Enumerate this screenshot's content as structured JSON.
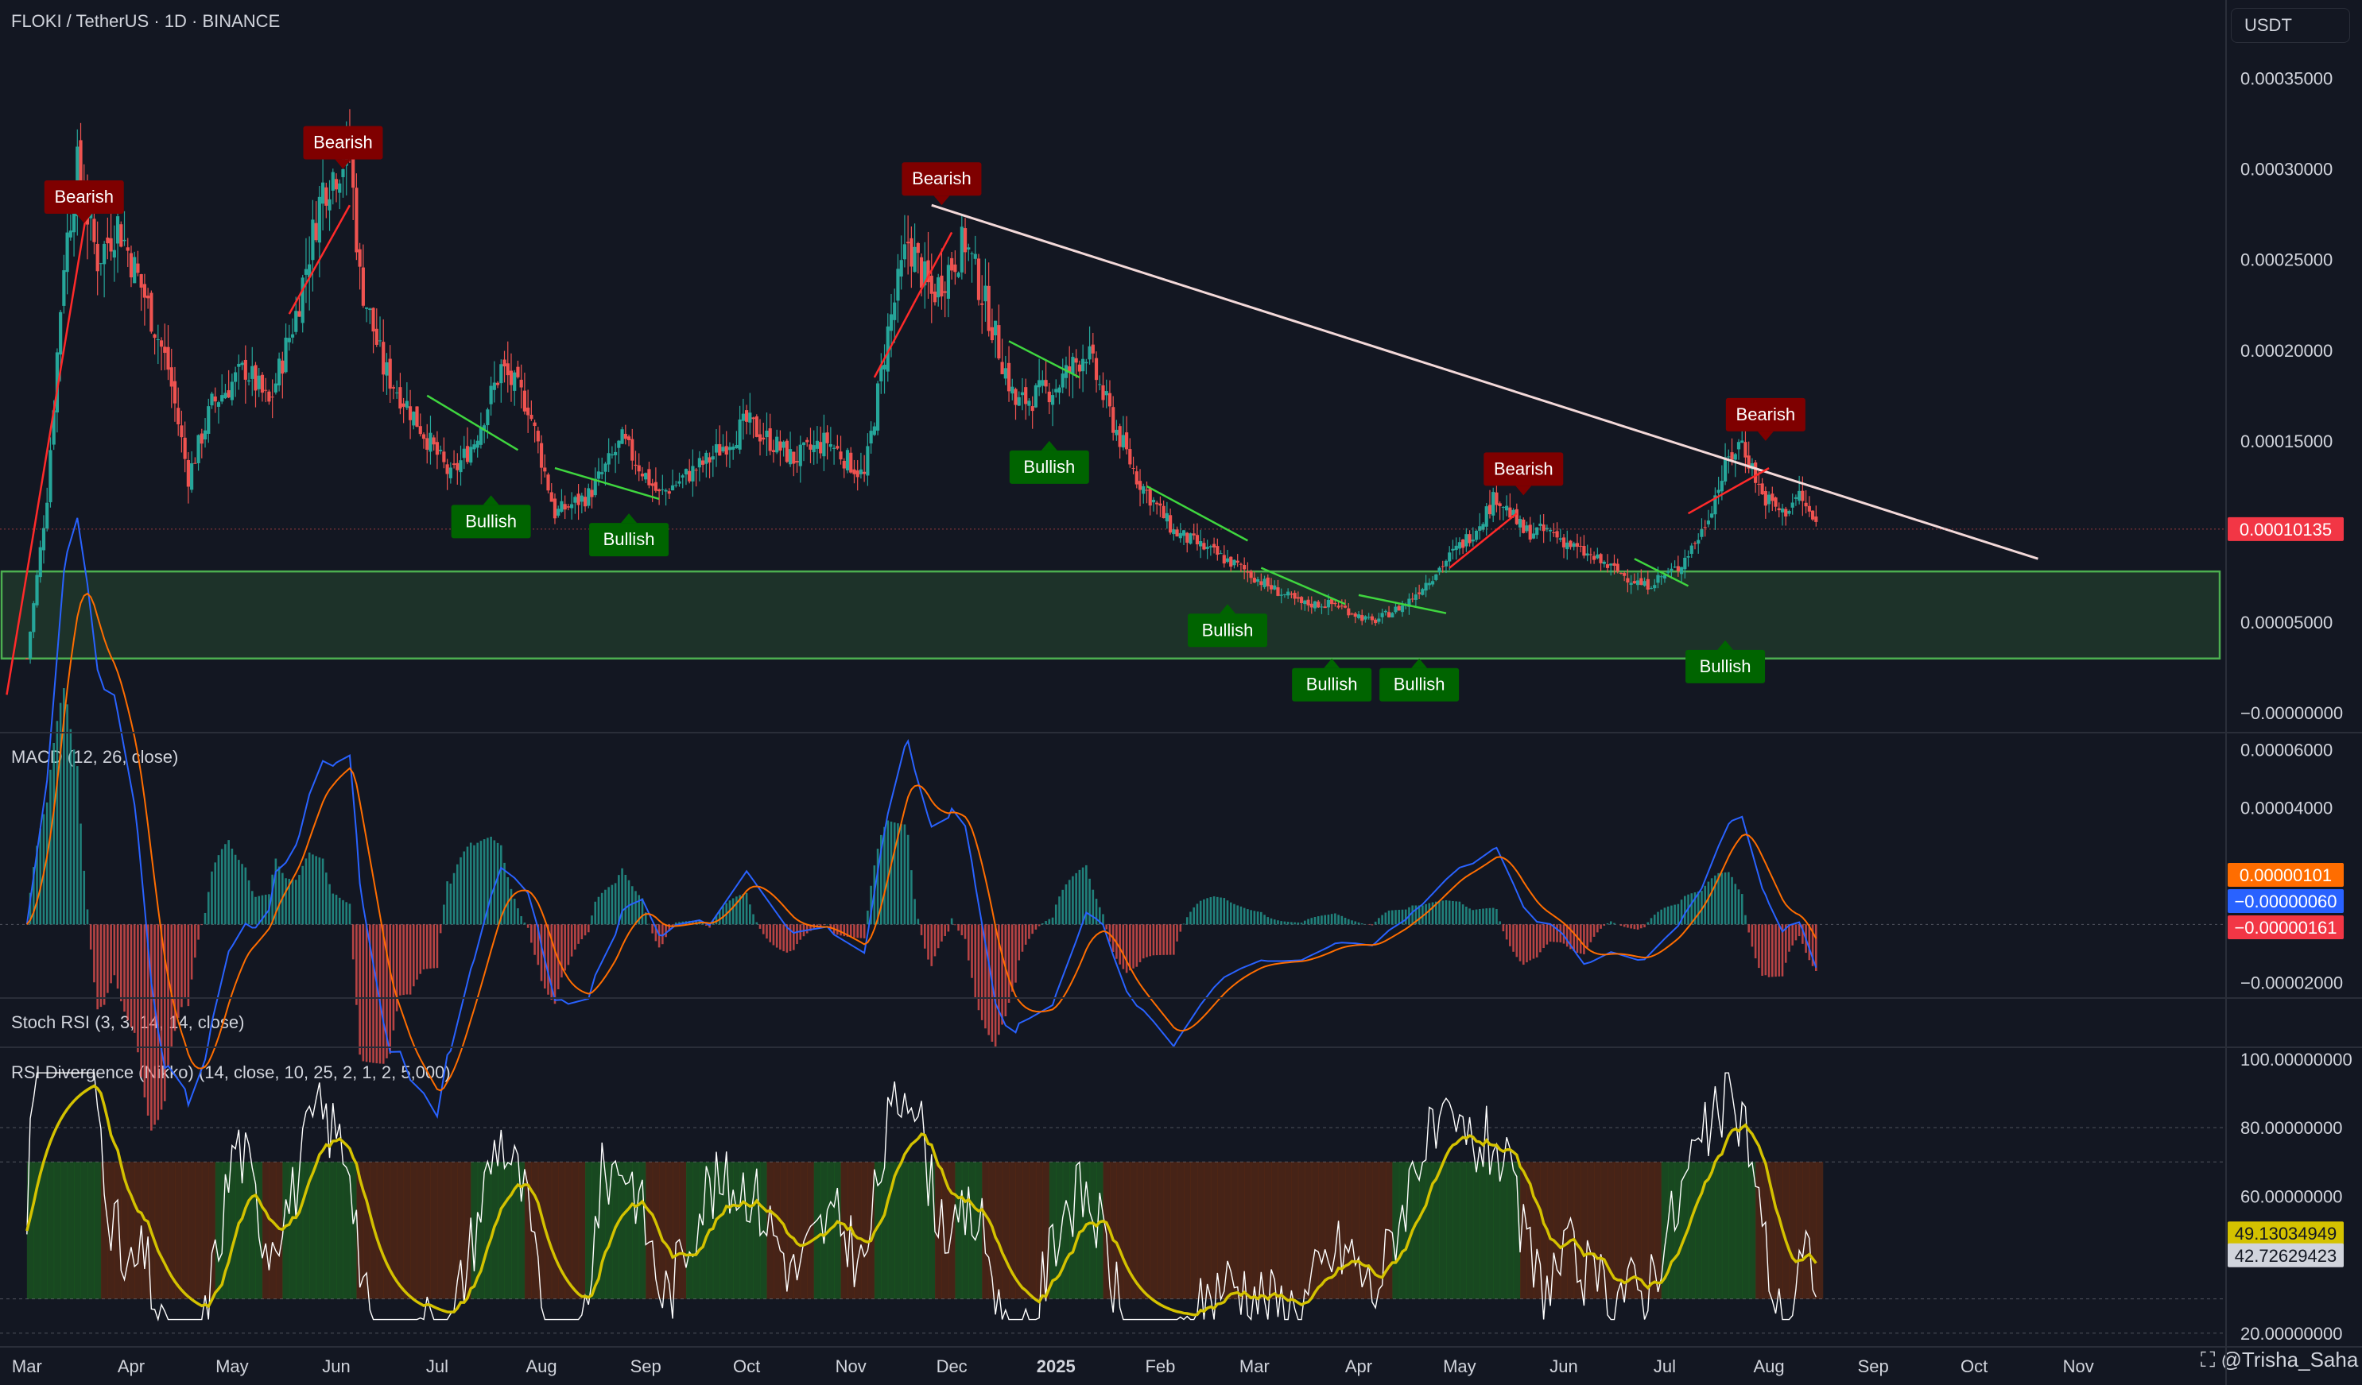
{
  "header": {
    "title": "FLOKI / TetherUS · 1D · BINANCE",
    "currency": "USDT"
  },
  "panes": {
    "macd_title": "MACD (12, 26, close)",
    "stoch_title": "Stoch RSI (3, 3, 14, 14, close)",
    "rsi_title": "RSI Divergence (Nikko) (14, close, 10, 25, 2, 1, 2, 5,000)"
  },
  "watermark": "@Trisha_Saha",
  "colors": {
    "background": "#131722",
    "bull_candle": "#26a69a",
    "bear_candle": "#ef5350",
    "bearish_label": "#7f0000",
    "bullish_label": "#006400",
    "support_zone": "#4caf50",
    "trendline": "#f3d9d9",
    "price_tag": "#f23645",
    "macd_line": "#2962ff",
    "signal_line": "#ff6d00",
    "rsi_line": "#ffffff",
    "rsi_ma": "#d4c200"
  },
  "chart_data": [
    {
      "type": "candlestick",
      "title": "FLOKI / TetherUS · 1D · BINANCE",
      "x_ticks": [
        "Mar",
        "Apr",
        "May",
        "Jun",
        "Jul",
        "Aug",
        "Sep",
        "Oct",
        "Nov",
        "Dec",
        "2025",
        "Feb",
        "Mar",
        "Apr",
        "May",
        "Jun",
        "Jul",
        "Aug",
        "Sep",
        "Oct",
        "Nov"
      ],
      "y_ticks": [
        "0.00035000",
        "0.00030000",
        "0.00025000",
        "0.00020000",
        "0.00015000",
        "0.00005000",
        "−0.00000000"
      ],
      "ylim": [
        -1e-05,
        0.00038
      ],
      "last_price": "0.00010135",
      "close_series": [
        {
          "date": "2024-03-01",
          "v": 3e-05
        },
        {
          "date": "2024-03-07",
          "v": 0.00012
        },
        {
          "date": "2024-03-12",
          "v": 0.00025
        },
        {
          "date": "2024-03-16",
          "v": 0.0003
        },
        {
          "date": "2024-03-22",
          "v": 0.00025
        },
        {
          "date": "2024-03-28",
          "v": 0.00027
        },
        {
          "date": "2024-04-05",
          "v": 0.00023
        },
        {
          "date": "2024-04-12",
          "v": 0.00019
        },
        {
          "date": "2024-04-18",
          "v": 0.00013
        },
        {
          "date": "2024-04-25",
          "v": 0.00017
        },
        {
          "date": "2024-05-05",
          "v": 0.00019
        },
        {
          "date": "2024-05-12",
          "v": 0.00017
        },
        {
          "date": "2024-05-20",
          "v": 0.00022
        },
        {
          "date": "2024-05-28",
          "v": 0.00029
        },
        {
          "date": "2024-06-05",
          "v": 0.00031
        },
        {
          "date": "2024-06-08",
          "v": 0.00024
        },
        {
          "date": "2024-06-15",
          "v": 0.00019
        },
        {
          "date": "2024-06-22",
          "v": 0.00017
        },
        {
          "date": "2024-07-05",
          "v": 0.00013
        },
        {
          "date": "2024-07-12",
          "v": 0.00015
        },
        {
          "date": "2024-07-20",
          "v": 0.00019
        },
        {
          "date": "2024-07-28",
          "v": 0.00017
        },
        {
          "date": "2024-08-05",
          "v": 0.00011
        },
        {
          "date": "2024-08-15",
          "v": 0.00012
        },
        {
          "date": "2024-08-25",
          "v": 0.00015
        },
        {
          "date": "2024-09-05",
          "v": 0.00012
        },
        {
          "date": "2024-09-20",
          "v": 0.00014
        },
        {
          "date": "2024-10-01",
          "v": 0.00016
        },
        {
          "date": "2024-10-15",
          "v": 0.00014
        },
        {
          "date": "2024-10-25",
          "v": 0.00015
        },
        {
          "date": "2024-11-05",
          "v": 0.00013
        },
        {
          "date": "2024-11-12",
          "v": 0.00021
        },
        {
          "date": "2024-11-18",
          "v": 0.00026
        },
        {
          "date": "2024-11-25",
          "v": 0.00023
        },
        {
          "date": "2024-12-05",
          "v": 0.00026
        },
        {
          "date": "2024-12-12",
          "v": 0.00022
        },
        {
          "date": "2024-12-20",
          "v": 0.00017
        },
        {
          "date": "2025-01-01",
          "v": 0.00018
        },
        {
          "date": "2025-01-10",
          "v": 0.0002
        },
        {
          "date": "2025-01-18",
          "v": 0.00016
        },
        {
          "date": "2025-01-25",
          "v": 0.00013
        },
        {
          "date": "2025-02-05",
          "v": 0.0001
        },
        {
          "date": "2025-02-15",
          "v": 9e-05
        },
        {
          "date": "2025-02-25",
          "v": 8e-05
        },
        {
          "date": "2025-03-05",
          "v": 7e-05
        },
        {
          "date": "2025-03-15",
          "v": 6e-05
        },
        {
          "date": "2025-03-25",
          "v": 6e-05
        },
        {
          "date": "2025-04-05",
          "v": 5e-05
        },
        {
          "date": "2025-04-15",
          "v": 6e-05
        },
        {
          "date": "2025-04-25",
          "v": 8e-05
        },
        {
          "date": "2025-05-05",
          "v": 0.0001
        },
        {
          "date": "2025-05-12",
          "v": 0.00012
        },
        {
          "date": "2025-05-20",
          "v": 0.0001
        },
        {
          "date": "2025-05-28",
          "v": 0.0001
        },
        {
          "date": "2025-06-05",
          "v": 9e-05
        },
        {
          "date": "2025-06-15",
          "v": 8e-05
        },
        {
          "date": "2025-06-25",
          "v": 7e-05
        },
        {
          "date": "2025-07-05",
          "v": 8e-05
        },
        {
          "date": "2025-07-12",
          "v": 0.0001
        },
        {
          "date": "2025-07-20",
          "v": 0.00014
        },
        {
          "date": "2025-07-24",
          "v": 0.00015
        },
        {
          "date": "2025-07-30",
          "v": 0.00012
        },
        {
          "date": "2025-08-05",
          "v": 0.00011
        },
        {
          "date": "2025-08-10",
          "v": 0.00012
        },
        {
          "date": "2025-08-16",
          "v": 0.0001
        }
      ],
      "trendline": [
        {
          "date": "2024-11-25",
          "v": 0.00028
        },
        {
          "date": "2025-10-20",
          "v": 8.5e-05
        }
      ],
      "support_zone": [
        3e-05,
        7.8e-05
      ],
      "divergence_labels": [
        {
          "text": "Bearish",
          "date": "2024-03-18",
          "v": 0.00027,
          "kind": "bearish"
        },
        {
          "text": "Bearish",
          "date": "2024-06-03",
          "v": 0.0003,
          "kind": "bearish"
        },
        {
          "text": "Bullish",
          "date": "2024-07-17",
          "v": 0.00012,
          "kind": "bullish"
        },
        {
          "text": "Bullish",
          "date": "2024-08-27",
          "v": 0.00011,
          "kind": "bullish"
        },
        {
          "text": "Bearish",
          "date": "2024-11-28",
          "v": 0.00028,
          "kind": "bearish"
        },
        {
          "text": "Bullish",
          "date": "2024-12-30",
          "v": 0.00015,
          "kind": "bullish"
        },
        {
          "text": "Bullish",
          "date": "2025-02-21",
          "v": 6e-05,
          "kind": "bullish"
        },
        {
          "text": "Bullish",
          "date": "2025-03-24",
          "v": 3e-05,
          "kind": "bullish"
        },
        {
          "text": "Bullish",
          "date": "2025-04-19",
          "v": 3e-05,
          "kind": "bullish"
        },
        {
          "text": "Bearish",
          "date": "2025-05-20",
          "v": 0.00012,
          "kind": "bearish"
        },
        {
          "text": "Bearish",
          "date": "2025-07-31",
          "v": 0.00015,
          "kind": "bearish"
        },
        {
          "text": "Bullish",
          "date": "2025-07-19",
          "v": 4e-05,
          "kind": "bullish"
        }
      ]
    },
    {
      "type": "macd",
      "title": "MACD (12, 26, close)",
      "y_ticks": [
        "0.00006000",
        "0.00004000",
        "−0.00002000"
      ],
      "ylim": [
        -2.5e-05,
        6.5e-05
      ],
      "value_tags": [
        "0.00000101",
        "−0.00000060",
        "−0.00000161"
      ]
    },
    {
      "type": "line",
      "title": "RSI Divergence (Nikko) (14, close, 10, 25, 2, 1, 2, 5,000)",
      "y_ticks": [
        "100.00000000",
        "80.00000000",
        "60.00000000",
        "20.00000000"
      ],
      "ylim": [
        16,
        103
      ],
      "value_tags": [
        "49.13034949",
        "42.72629423"
      ]
    }
  ]
}
